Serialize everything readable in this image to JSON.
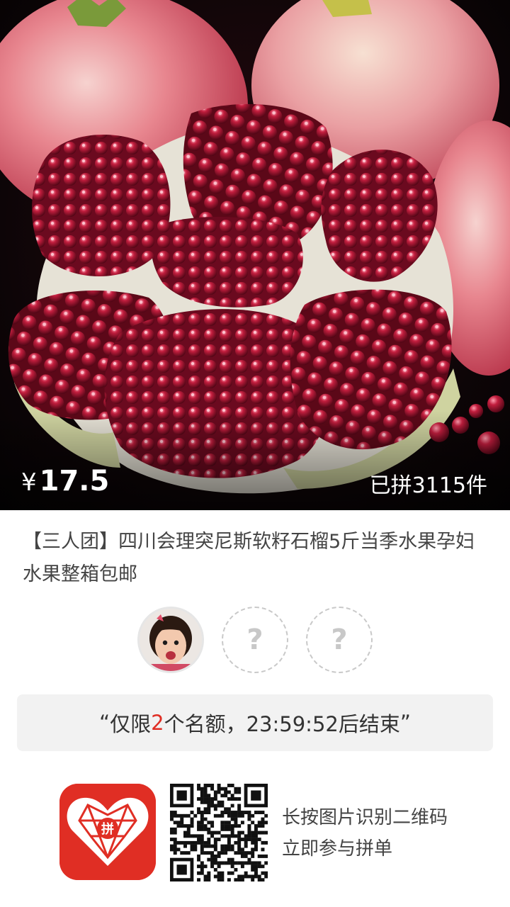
{
  "product": {
    "currency": "¥",
    "price": "17.5",
    "sold": "已拼3115件",
    "title": "【三人团】四川会理突尼斯软籽石榴5斤当季水果孕妇水果整箱包邮"
  },
  "group": {
    "slots": [
      "?",
      "?"
    ]
  },
  "notice": {
    "open_quote": "“",
    "prefix": "仅限",
    "count": "2",
    "suffix": "个名额，23:59:52后结束",
    "close_quote": "”"
  },
  "footer": {
    "line1": "长按图片识别二维码",
    "line2": "立即参与拼单",
    "brand_mark": "拼"
  },
  "colors": {
    "accent": "#e02e24",
    "notice_bg": "#f2f2f2"
  }
}
